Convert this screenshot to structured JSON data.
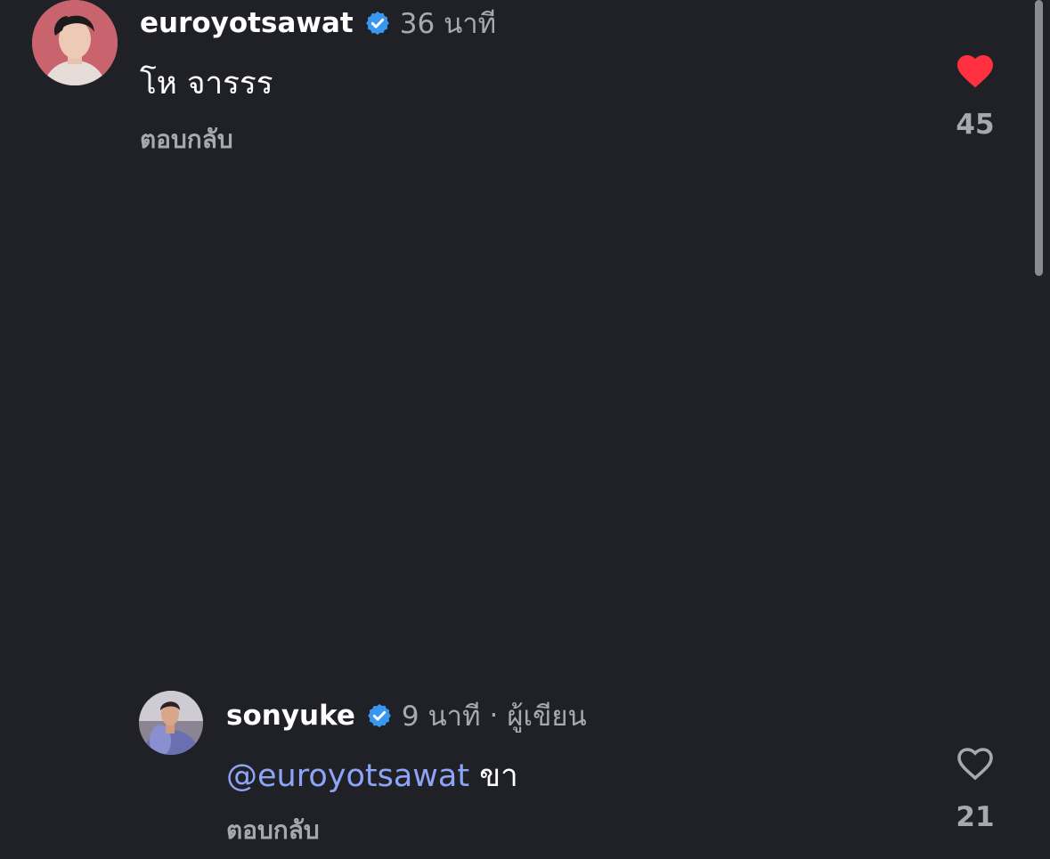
{
  "comments": [
    {
      "username": "euroyotsawat",
      "verified": true,
      "time": "36 นาที",
      "text": "โห จาร​รร",
      "reply_label": "ตอบกลับ",
      "liked": true,
      "like_count": "45",
      "like_color": "#ff3040"
    },
    {
      "username": "sonyuke",
      "verified": true,
      "time": "9 นาที",
      "separator": "·",
      "author_tag": "ผู้เขียน",
      "mention": "@euroyotsawat",
      "text": "ขา",
      "reply_label": "ตอบกลับ",
      "liked": false,
      "like_count": "21"
    }
  ],
  "colors": {
    "background": "#202127",
    "verified_badge": "#3897f0",
    "mention": "#8da4f7",
    "muted_text": "#a8a9ad"
  }
}
